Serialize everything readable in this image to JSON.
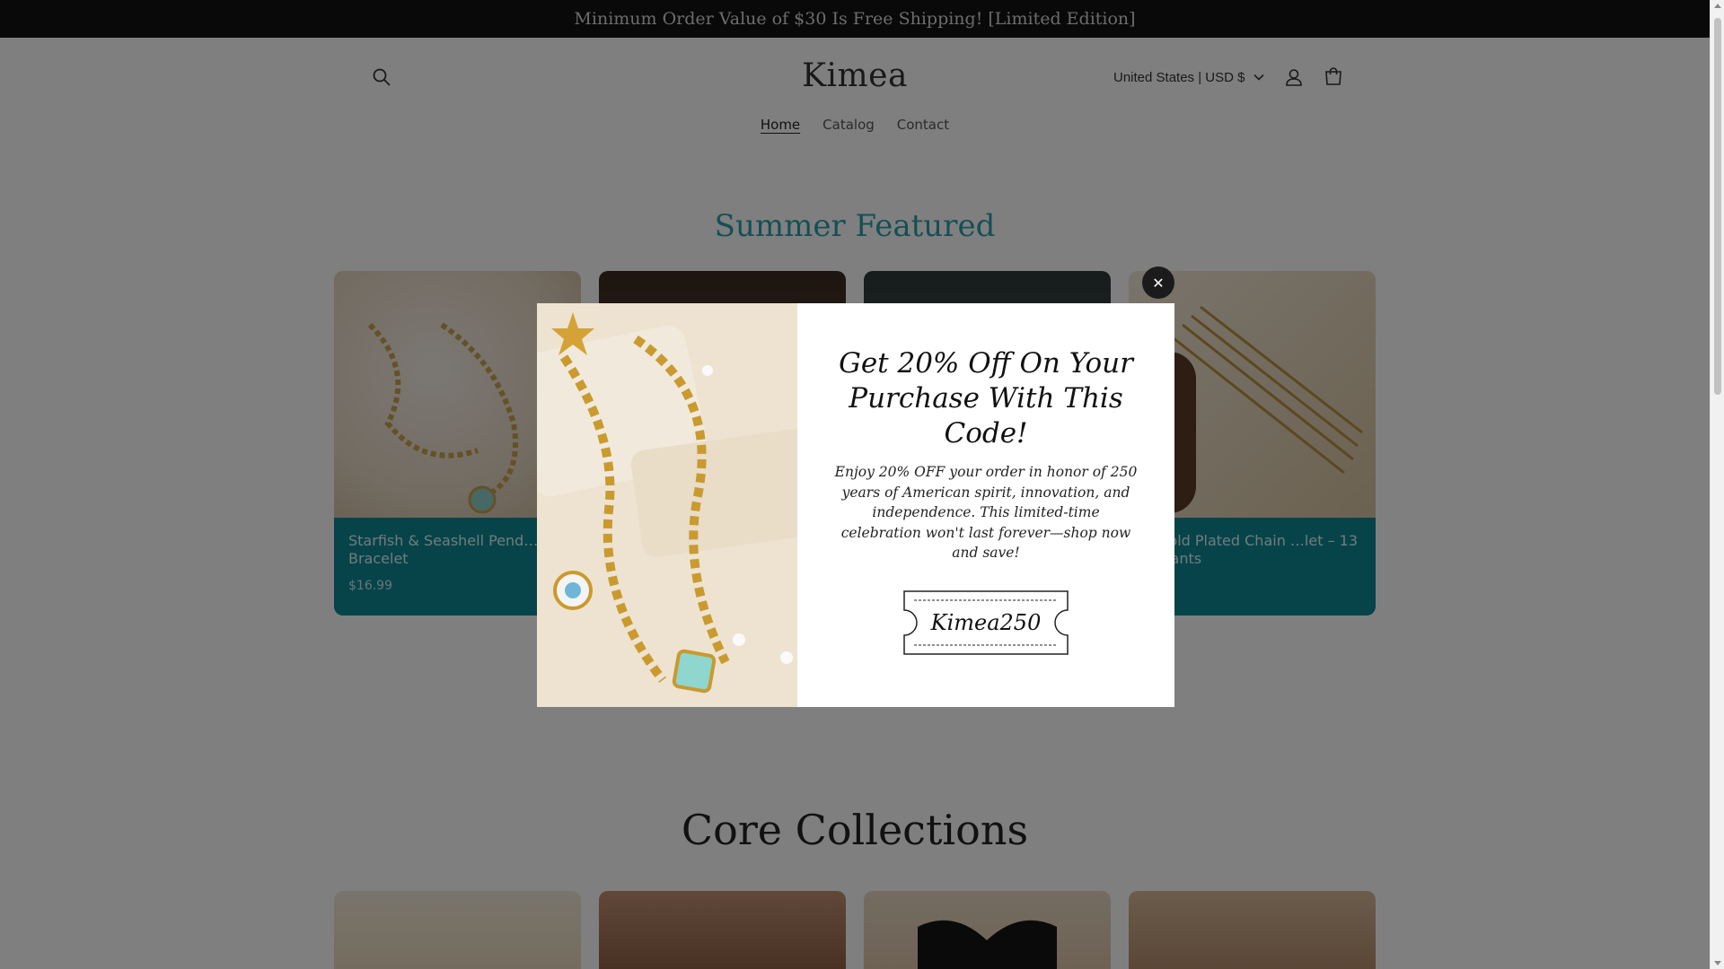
{
  "announcement": "Minimum Order Value of $30 Is Free Shipping! [Limited Edition]",
  "header": {
    "logo": "Kimea",
    "locale": "United States | USD $",
    "icons": {
      "search": "search-icon",
      "account": "account-icon",
      "cart": "cart-icon",
      "chevron": "chevron-down-icon"
    }
  },
  "nav": {
    "items": [
      {
        "label": "Home",
        "active": true
      },
      {
        "label": "Catalog",
        "active": false
      },
      {
        "label": "Contact",
        "active": false
      }
    ]
  },
  "summer": {
    "title": "Summer Featured",
    "products": [
      {
        "name": "Starfish & Seashell Pend… Bracelet",
        "price": "$16.99"
      },
      {
        "name": "",
        "price": ""
      },
      {
        "name": "",
        "price": ""
      },
      {
        "name": "…Gold Plated Chain …let – 13 Variants",
        "price": "…9"
      }
    ]
  },
  "core": {
    "title": "Core Collections"
  },
  "popup": {
    "heading": "Get 20% Off On Your Purchase With This Code!",
    "text": "Enjoy 20% OFF your order in honor of 250 years of American spirit, innovation, and independence. This limited-time celebration won't last forever—shop now and save!",
    "code": "Kimea250",
    "close": "✕"
  },
  "colors": {
    "accent": "#2a9fad",
    "card_info_bg": "#0d8895",
    "announcement_bg": "#121212",
    "overlay": "rgba(0,0,0,0.5)"
  }
}
